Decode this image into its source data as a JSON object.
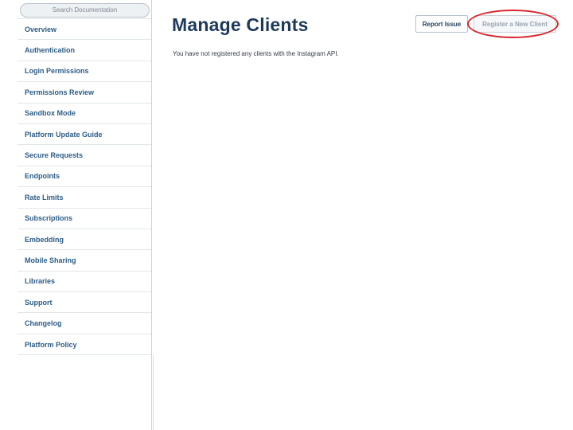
{
  "sidebar": {
    "search_placeholder": "Search Documentation",
    "items": [
      {
        "label": "Overview"
      },
      {
        "label": "Authentication"
      },
      {
        "label": "Login Permissions"
      },
      {
        "label": "Permissions Review"
      },
      {
        "label": "Sandbox Mode"
      },
      {
        "label": "Platform Update Guide"
      },
      {
        "label": "Secure Requests"
      },
      {
        "label": "Endpoints"
      },
      {
        "label": "Rate Limits"
      },
      {
        "label": "Subscriptions"
      },
      {
        "label": "Embedding"
      },
      {
        "label": "Mobile Sharing"
      },
      {
        "label": "Libraries"
      },
      {
        "label": "Support"
      },
      {
        "label": "Changelog"
      },
      {
        "label": "Platform Policy"
      }
    ]
  },
  "main": {
    "title": "Manage Clients",
    "intro_text": "You have not registered any clients with the Instagram API.",
    "report_issue_label": "Report Issue",
    "register_client_label": "Register a New Client"
  },
  "colors": {
    "title": "#1d3a5c",
    "nav_link": "#2c5c86",
    "highlight_ring": "#d9252c",
    "disabled_button_text": "#9aa5b0"
  }
}
